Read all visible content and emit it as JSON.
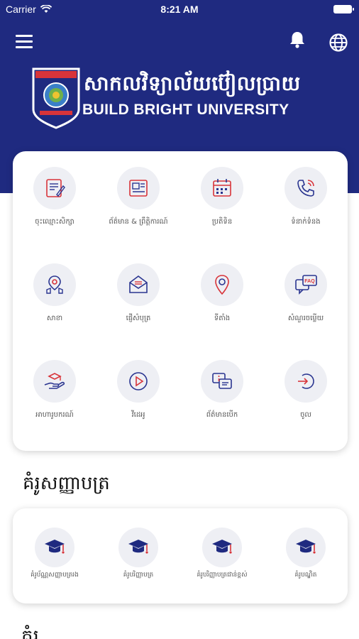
{
  "status_bar": {
    "carrier": "Carrier",
    "time": "8:21 AM"
  },
  "header": {
    "university_kh": "សាកលវិទ្យាល័យប៊ៀលប្រាយ",
    "university_en": "BUILD BRIGHT UNIVERSITY",
    "icons": [
      "menu-icon",
      "bell-icon",
      "globe-icon"
    ]
  },
  "menu": {
    "items": [
      {
        "label": "ចុះឈ្មោះសិក្សា",
        "icon": "registration-form-icon"
      },
      {
        "label": "ព័ត៌មាន & ព្រឹត្តិការណ៍",
        "icon": "news-icon"
      },
      {
        "label": "ប្រតិទិន",
        "icon": "calendar-icon"
      },
      {
        "label": "ទំនាក់ទំនង",
        "icon": "phone-icon"
      },
      {
        "label": "សាខា",
        "icon": "branch-location-icon"
      },
      {
        "label": "ផ្ញើសំបុត្រ",
        "icon": "mail-icon"
      },
      {
        "label": "ទីតាំង",
        "icon": "map-pin-icon"
      },
      {
        "label": "សំណួរចម្លើយ",
        "icon": "faq-icon"
      },
      {
        "label": "អាហារូបករណ៍",
        "icon": "scholarship-icon"
      },
      {
        "label": "វីដេអូ",
        "icon": "video-play-icon"
      },
      {
        "label": "ព័ត៌មានបើក",
        "icon": "info-chat-icon"
      },
      {
        "label": "ចូល",
        "icon": "login-icon"
      }
    ]
  },
  "templates": {
    "title": "គំរូសញ្ញាបត្រ",
    "items": [
      {
        "label": "គំរូប័ណ្ណសញ្ញាបត្ររង",
        "icon": "graduation-cap-icon"
      },
      {
        "label": "គំរូបរិញ្ញាបត្រ",
        "icon": "graduation-cap-icon"
      },
      {
        "label": "គំរូបរិញ្ញាបត្រជាន់ខ្ពស់",
        "icon": "graduation-cap-icon"
      },
      {
        "label": "គំរូបណ្ឌិត",
        "icon": "graduation-cap-icon"
      }
    ]
  },
  "next_section": {
    "title": "គំរូ"
  },
  "colors": {
    "brand_navy": "#1f2a80",
    "accent_red": "#d8343a",
    "icon_blue": "#2a3590",
    "tile_bg": "#eeeff4"
  }
}
